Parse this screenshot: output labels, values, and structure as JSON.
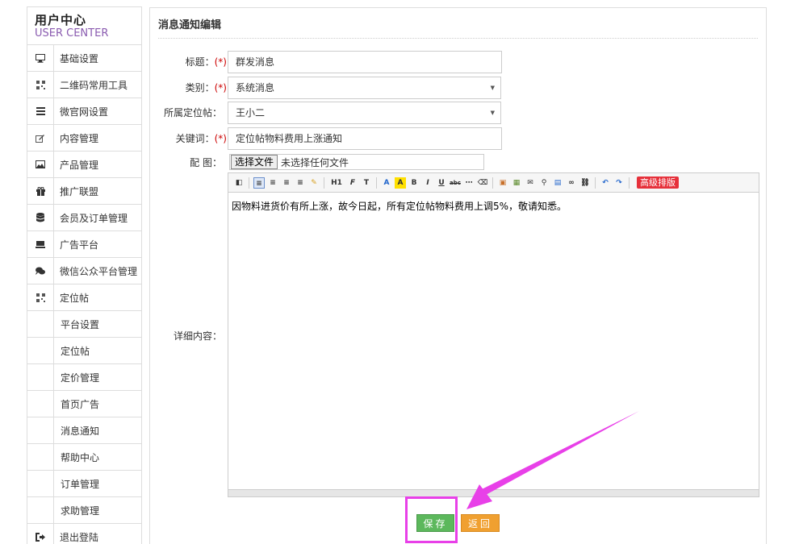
{
  "sidebar": {
    "brand_cn": "用户中心",
    "brand_en": "USER CENTER",
    "items": [
      {
        "label": "基础设置",
        "icon": "monitor-icon"
      },
      {
        "label": "二维码常用工具",
        "icon": "qrcode-icon"
      },
      {
        "label": "微官网设置",
        "icon": "list-icon"
      },
      {
        "label": "内容管理",
        "icon": "edit-icon"
      },
      {
        "label": "产品管理",
        "icon": "image-icon"
      },
      {
        "label": "推广联盟",
        "icon": "gift-icon"
      },
      {
        "label": "会员及订单管理",
        "icon": "database-icon"
      },
      {
        "label": "广告平台",
        "icon": "keyboard-icon"
      },
      {
        "label": "微信公众平台管理",
        "icon": "chat-icon"
      },
      {
        "label": "定位帖",
        "icon": "qrcode-icon"
      }
    ],
    "subitems": [
      {
        "label": "平台设置"
      },
      {
        "label": "定位帖"
      },
      {
        "label": "定价管理"
      },
      {
        "label": "首页广告"
      },
      {
        "label": "消息通知"
      },
      {
        "label": "帮助中心"
      },
      {
        "label": "订单管理"
      },
      {
        "label": "求助管理"
      }
    ],
    "logout": {
      "label": "退出登陆",
      "icon": "logout-icon"
    }
  },
  "form": {
    "title": "消息通知编辑",
    "required_mark": "(*)",
    "title_label": "标题：",
    "title_value": "群发消息",
    "category_label": "类别：",
    "category_value": "系统消息",
    "post_label": "所属定位帖：",
    "post_value": "王小二",
    "keyword_label": "关键词：",
    "keyword_value": "定位帖物料费用上涨通知",
    "image_label": "配 图：",
    "file_button": "选择文件",
    "file_status": "未选择任何文件",
    "content_label": "详细内容：",
    "content_text": "因物料进货价有所上涨，故今日起，所有定位帖物料费用上调5%，敬请知悉。",
    "toolbar_heading": "H1",
    "toolbar_advanced": "高级排版",
    "save_label": "保存",
    "back_label": "返回"
  },
  "colors": {
    "save": "#5cb85c",
    "back": "#f0a030",
    "highlight": "#e840e8"
  }
}
